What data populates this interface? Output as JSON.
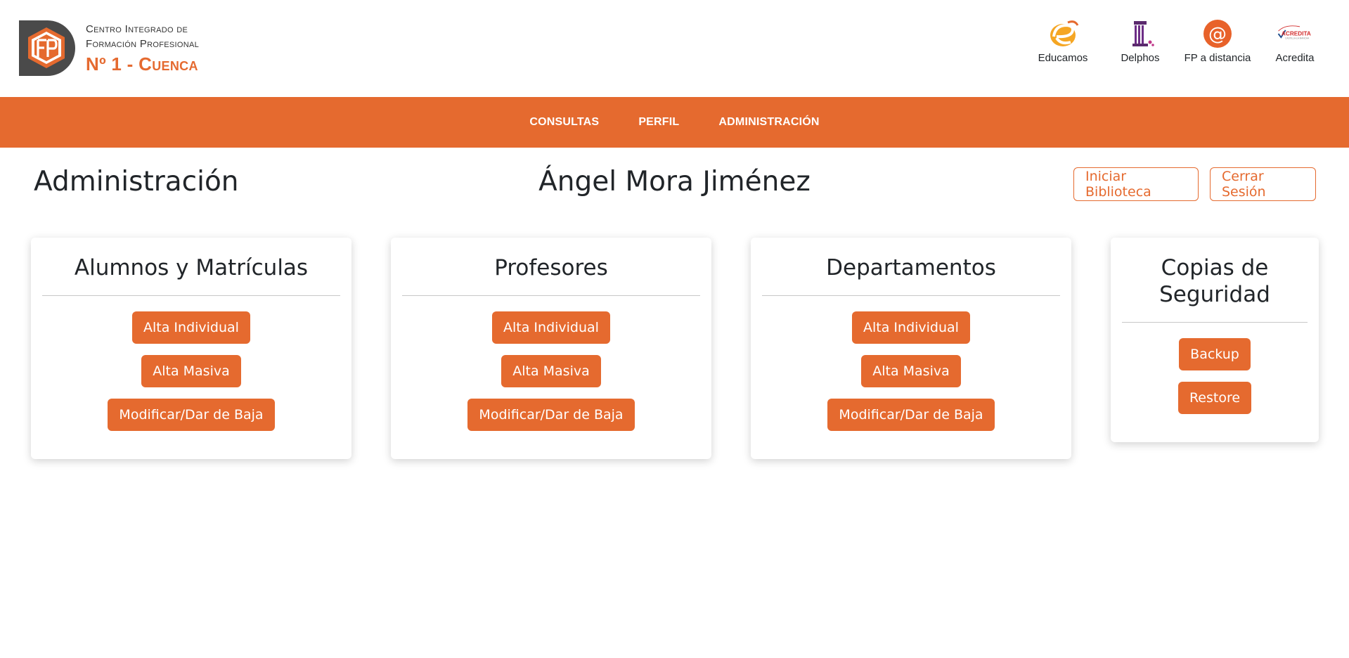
{
  "header": {
    "school_line1": "Centro Integrado de",
    "school_line2": "Formación Profesional",
    "school_line3": "Nº 1 - Cuenca",
    "links": [
      {
        "label": "Educamos",
        "icon": "educamos-logo-icon"
      },
      {
        "label": "Delphos",
        "icon": "delphos-logo-icon"
      },
      {
        "label": "FP a distancia",
        "icon": "fp-distancia-at-icon"
      },
      {
        "label": "Acredita",
        "icon": "acredita-logo-icon"
      }
    ],
    "acredita_logo_text": "ACREDITA",
    "acredita_logo_subtext": "CASTILLA-LA MANCHA"
  },
  "nav": {
    "items": [
      "CONSULTAS",
      "PERFIL",
      "ADMINISTRACIÓN"
    ]
  },
  "main": {
    "title": "Administración",
    "user_name": "Ángel Mora Jiménez",
    "start_library_label": "Iniciar Biblioteca",
    "logout_label": "Cerrar Sesión"
  },
  "cards": [
    {
      "title": "Alumnos y Matrículas",
      "buttons": [
        "Alta Individual",
        "Alta Masiva",
        "Modificar/Dar de Baja"
      ]
    },
    {
      "title": "Profesores",
      "buttons": [
        "Alta Individual",
        "Alta Masiva",
        "Modificar/Dar de Baja"
      ]
    },
    {
      "title": "Departamentos",
      "buttons": [
        "Alta Individual",
        "Alta Masiva",
        "Modificar/Dar de Baja"
      ]
    },
    {
      "title": "Copias de Seguridad",
      "buttons": [
        "Backup",
        "Restore"
      ]
    }
  ],
  "colors": {
    "accent": "#e56a2f",
    "logo_dark": "#4a4a4a",
    "text": "#212529"
  }
}
